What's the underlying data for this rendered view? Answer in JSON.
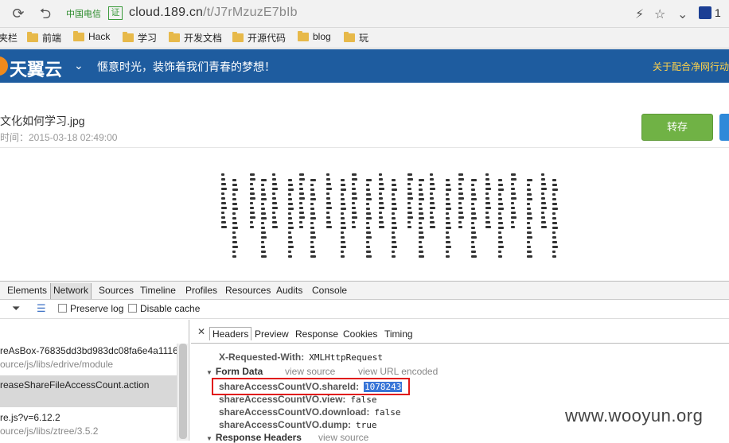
{
  "browser": {
    "carrier": "中国电信",
    "cert_badge": "证",
    "url_domain": "cloud.189.cn",
    "url_path": "/t/J7rMzuzE7bIb",
    "extension_count": "1"
  },
  "bookmarks": {
    "partial": "夹栏",
    "items": [
      "前端",
      "Hack",
      "学习",
      "开发文档",
      "开源代码",
      "blog",
      "玩"
    ]
  },
  "site": {
    "logo_text": "天翼云",
    "slogan": "惬意时光，装饰着我们青春的梦想！",
    "notice": "关于配合净网行动"
  },
  "file": {
    "name": "文化如何学习.jpg",
    "time": "时间：2015-03-18 02:49:00",
    "save_label": "转存"
  },
  "devtools": {
    "tabs": [
      "Elements",
      "Network",
      "Sources",
      "Timeline",
      "Profiles",
      "Resources",
      "Audits",
      "Console"
    ],
    "active_tab": "Network",
    "preserve_log": "Preserve log",
    "disable_cache": "Disable cache",
    "requests": [
      {
        "name": "reAsBox-76835dd3bd983dc08fa6e4a1116...",
        "path": "ource/js/libs/edrive/module"
      },
      {
        "name": "reaseShareFileAccessCount.action",
        "path": ""
      },
      {
        "name": "re.js?v=6.12.2",
        "path": "ource/js/libs/ztree/3.5.2"
      }
    ],
    "detail_tabs": [
      "Headers",
      "Preview",
      "Response",
      "Cookies",
      "Timing"
    ],
    "active_detail_tab": "Headers",
    "header_row": {
      "key": "X-Requested-With:",
      "value": "XMLHttpRequest"
    },
    "form_data": {
      "title": "Form Data",
      "view_source": "view source",
      "view_url_encoded": "view URL encoded",
      "fields": [
        {
          "key": "shareAccessCountVO.shareId:",
          "value": "1078243"
        },
        {
          "key": "shareAccessCountVO.view:",
          "value": "false"
        },
        {
          "key": "shareAccessCountVO.download:",
          "value": "false"
        },
        {
          "key": "shareAccessCountVO.dump:",
          "value": "true"
        }
      ]
    },
    "response_headers": {
      "title": "Response Headers",
      "view_source": "view source"
    }
  },
  "watermark": "www.wooyun.org",
  "colors": {
    "header_blue": "#1e5c9f",
    "save_green": "#70b245",
    "highlight_red": "#e01818",
    "selection_blue": "#3875d7"
  }
}
